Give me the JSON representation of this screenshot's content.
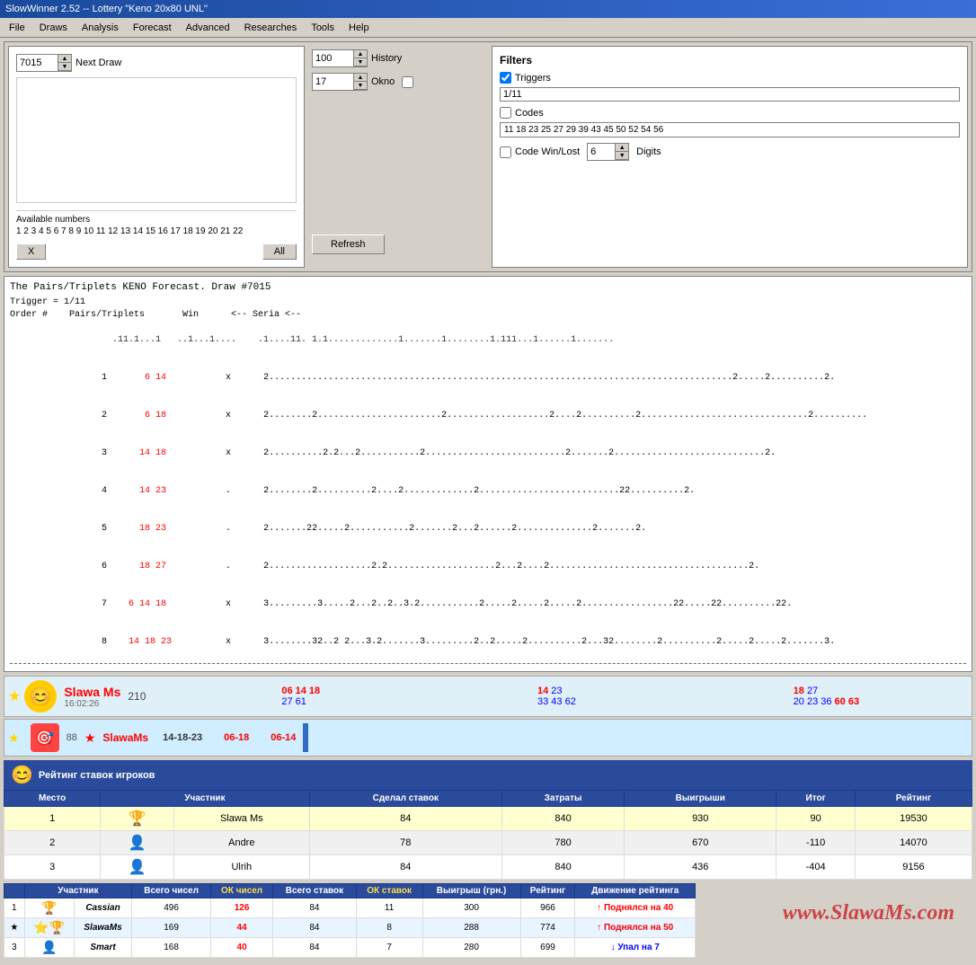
{
  "titleBar": {
    "title": "SlowWinner 2.52 -- Lottery \"Keno 20x80 UNL\""
  },
  "menuBar": {
    "items": [
      "File",
      "Draws",
      "Analysis",
      "Forecast",
      "Advanced",
      "Researches",
      "Tools",
      "Help"
    ]
  },
  "topPanel": {
    "drawNumber": "7015",
    "drawLabel": "Next Draw",
    "history": {
      "value": "100",
      "label": "History"
    },
    "okno": {
      "value": "17",
      "label": "Okno"
    },
    "availableLabel": "Available numbers",
    "availableNumbers": "1 2 3 4 5 6 7 8 9 10 11 12 13 14 15 16 17 18 19 20 21 22",
    "xButton": "X",
    "allButton": "All",
    "refreshButton": "Refresh"
  },
  "filters": {
    "title": "Filters",
    "triggers": {
      "checked": true,
      "label": "Triggers",
      "value": "1/11"
    },
    "codes": {
      "checked": false,
      "label": "Codes",
      "value": "11 18 23 25 27 29 39 43 45 50 52 54 56"
    },
    "codeWinLost": {
      "checked": false,
      "label": "Code Win/Lost",
      "value": "6",
      "digitsLabel": "Digits"
    }
  },
  "forecast": {
    "title": "The Pairs/Triplets KENO Forecast. Draw #7015",
    "trigger": "Trigger = 1/11",
    "headerLine": "Order #    Pairs/Triplets       Win      <-- Seria <--",
    "dotLine": "             .11.1...1   ..1...1....   .1....11. 1.1.............1.......1........1.111...1......1.......",
    "rows": [
      {
        "order": "1",
        "pairs": "6 14",
        "win": "x",
        "data": "2......................................................................................2.....2..........2."
      },
      {
        "order": "2",
        "pairs": "6 18",
        "win": "x",
        "data": "2........2.......................2...................2....2..........2...............................2.........."
      },
      {
        "order": "3",
        "pairs": "14 18",
        "win": "x",
        "data": "2..........2.2...2...........2..........................2.......2............................2."
      },
      {
        "order": "4",
        "pairs": "14 23",
        "win": ".",
        "data": "2........2..........2....2.............2..........................22..........2."
      },
      {
        "order": "5",
        "pairs": "18 23",
        "win": ".",
        "data": "2.......22.....2...........2.......2...2......2..............2.......2."
      },
      {
        "order": "6",
        "pairs": "18 27",
        "win": ".",
        "data": "2...................2.2....................2...2....2.....................................2."
      },
      {
        "order": "7",
        "pairs": "6 14 18",
        "win": "x",
        "data": "3.........3.....2...2..2..3.2...........2.....2.....2.....2.................22.....22..........22."
      },
      {
        "order": "8",
        "pairs": "14 18 23",
        "win": "x",
        "data": "3........32..2 2...3.2.......3.........2..2.....2..........2...32........2..........2.....2.....2.......3."
      }
    ]
  },
  "playerCard1": {
    "starIcon": "★",
    "avatar": "😊",
    "score": "210",
    "name": "Slawa Ms",
    "time": "16:02:26",
    "numbers": [
      {
        "label": "06 14 18",
        "color": "red"
      },
      {
        "label": "27 61",
        "color": "blue"
      }
    ],
    "numbers2": [
      {
        "label": "14 23",
        "color": "blue"
      },
      {
        "label": "33 43 62",
        "color": "blue"
      }
    ],
    "numbers3": [
      {
        "label": "18 27",
        "color": "blue"
      },
      {
        "label": "20 23 36 60 63",
        "color": "blue"
      }
    ]
  },
  "playerCard2": {
    "starIcon": "★",
    "avatar": "🎯",
    "score": "88",
    "name": "SlawaMs",
    "nums": "14-18-23",
    "num2": "06-18",
    "num3": "06-14"
  },
  "ratingSection": {
    "title": "Рейтинг ставок игроков",
    "columns": [
      "Место",
      "Участник",
      "Сделал ставок",
      "Затраты",
      "Выигрыши",
      "Итог",
      "Рейтинг"
    ],
    "rows": [
      {
        "place": "1",
        "avatar": "🏆",
        "name": "Slawa Ms",
        "bets": "84",
        "costs": "840",
        "wins": "930",
        "total": "90",
        "rating": "19530"
      },
      {
        "place": "2",
        "avatar": "👤",
        "name": "Andre",
        "bets": "78",
        "costs": "780",
        "wins": "670",
        "total": "-110",
        "rating": "14070"
      },
      {
        "place": "3",
        "avatar": "👤",
        "name": "Ulrih",
        "bets": "84",
        "costs": "840",
        "wins": "436",
        "total": "-404",
        "rating": "9156"
      }
    ]
  },
  "bottomTable": {
    "columns": [
      "Участник",
      "Всего чисел",
      "ОК чисел",
      "Всего ставок",
      "ОК ставок",
      "Выигрыш (грн.)",
      "Рейтинг",
      "Движение рейтинга"
    ],
    "rows": [
      {
        "place": "1",
        "avatar": "🏆",
        "name": "Cassian",
        "totalNums": "496",
        "okNums": "126",
        "totalBets": "84",
        "okBets": "11",
        "win": "300",
        "rating": "966",
        "movement": "↑ Поднялся на 40",
        "moveColor": "red"
      },
      {
        "place": "★",
        "avatar": "⭐",
        "name": "SlawaMs",
        "totalNums": "169",
        "okNums": "44",
        "totalBets": "84",
        "okBets": "8",
        "win": "288",
        "rating": "774",
        "movement": "↑ Поднялся на 50",
        "moveColor": "red"
      },
      {
        "place": "3",
        "avatar": "👤",
        "name": "Smart",
        "totalNums": "168",
        "okNums": "40",
        "totalBets": "84",
        "okBets": "7",
        "win": "280",
        "rating": "699",
        "movement": "↓ Упал на 7",
        "moveColor": "blue"
      }
    ]
  },
  "watermark": "www.SlawaMs.com"
}
